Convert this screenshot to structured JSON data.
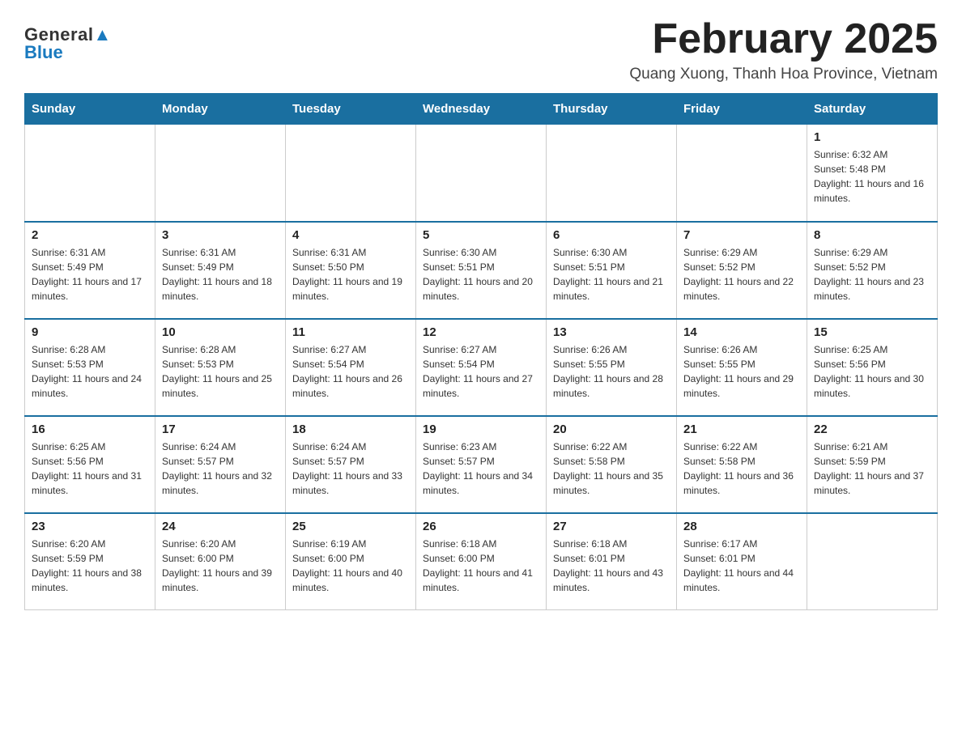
{
  "logo": {
    "general": "General",
    "blue": "Blue"
  },
  "title": "February 2025",
  "subtitle": "Quang Xuong, Thanh Hoa Province, Vietnam",
  "days_of_week": [
    "Sunday",
    "Monday",
    "Tuesday",
    "Wednesday",
    "Thursday",
    "Friday",
    "Saturday"
  ],
  "weeks": [
    [
      {
        "day": "",
        "info": ""
      },
      {
        "day": "",
        "info": ""
      },
      {
        "day": "",
        "info": ""
      },
      {
        "day": "",
        "info": ""
      },
      {
        "day": "",
        "info": ""
      },
      {
        "day": "",
        "info": ""
      },
      {
        "day": "1",
        "info": "Sunrise: 6:32 AM\nSunset: 5:48 PM\nDaylight: 11 hours and 16 minutes."
      }
    ],
    [
      {
        "day": "2",
        "info": "Sunrise: 6:31 AM\nSunset: 5:49 PM\nDaylight: 11 hours and 17 minutes."
      },
      {
        "day": "3",
        "info": "Sunrise: 6:31 AM\nSunset: 5:49 PM\nDaylight: 11 hours and 18 minutes."
      },
      {
        "day": "4",
        "info": "Sunrise: 6:31 AM\nSunset: 5:50 PM\nDaylight: 11 hours and 19 minutes."
      },
      {
        "day": "5",
        "info": "Sunrise: 6:30 AM\nSunset: 5:51 PM\nDaylight: 11 hours and 20 minutes."
      },
      {
        "day": "6",
        "info": "Sunrise: 6:30 AM\nSunset: 5:51 PM\nDaylight: 11 hours and 21 minutes."
      },
      {
        "day": "7",
        "info": "Sunrise: 6:29 AM\nSunset: 5:52 PM\nDaylight: 11 hours and 22 minutes."
      },
      {
        "day": "8",
        "info": "Sunrise: 6:29 AM\nSunset: 5:52 PM\nDaylight: 11 hours and 23 minutes."
      }
    ],
    [
      {
        "day": "9",
        "info": "Sunrise: 6:28 AM\nSunset: 5:53 PM\nDaylight: 11 hours and 24 minutes."
      },
      {
        "day": "10",
        "info": "Sunrise: 6:28 AM\nSunset: 5:53 PM\nDaylight: 11 hours and 25 minutes."
      },
      {
        "day": "11",
        "info": "Sunrise: 6:27 AM\nSunset: 5:54 PM\nDaylight: 11 hours and 26 minutes."
      },
      {
        "day": "12",
        "info": "Sunrise: 6:27 AM\nSunset: 5:54 PM\nDaylight: 11 hours and 27 minutes."
      },
      {
        "day": "13",
        "info": "Sunrise: 6:26 AM\nSunset: 5:55 PM\nDaylight: 11 hours and 28 minutes."
      },
      {
        "day": "14",
        "info": "Sunrise: 6:26 AM\nSunset: 5:55 PM\nDaylight: 11 hours and 29 minutes."
      },
      {
        "day": "15",
        "info": "Sunrise: 6:25 AM\nSunset: 5:56 PM\nDaylight: 11 hours and 30 minutes."
      }
    ],
    [
      {
        "day": "16",
        "info": "Sunrise: 6:25 AM\nSunset: 5:56 PM\nDaylight: 11 hours and 31 minutes."
      },
      {
        "day": "17",
        "info": "Sunrise: 6:24 AM\nSunset: 5:57 PM\nDaylight: 11 hours and 32 minutes."
      },
      {
        "day": "18",
        "info": "Sunrise: 6:24 AM\nSunset: 5:57 PM\nDaylight: 11 hours and 33 minutes."
      },
      {
        "day": "19",
        "info": "Sunrise: 6:23 AM\nSunset: 5:57 PM\nDaylight: 11 hours and 34 minutes."
      },
      {
        "day": "20",
        "info": "Sunrise: 6:22 AM\nSunset: 5:58 PM\nDaylight: 11 hours and 35 minutes."
      },
      {
        "day": "21",
        "info": "Sunrise: 6:22 AM\nSunset: 5:58 PM\nDaylight: 11 hours and 36 minutes."
      },
      {
        "day": "22",
        "info": "Sunrise: 6:21 AM\nSunset: 5:59 PM\nDaylight: 11 hours and 37 minutes."
      }
    ],
    [
      {
        "day": "23",
        "info": "Sunrise: 6:20 AM\nSunset: 5:59 PM\nDaylight: 11 hours and 38 minutes."
      },
      {
        "day": "24",
        "info": "Sunrise: 6:20 AM\nSunset: 6:00 PM\nDaylight: 11 hours and 39 minutes."
      },
      {
        "day": "25",
        "info": "Sunrise: 6:19 AM\nSunset: 6:00 PM\nDaylight: 11 hours and 40 minutes."
      },
      {
        "day": "26",
        "info": "Sunrise: 6:18 AM\nSunset: 6:00 PM\nDaylight: 11 hours and 41 minutes."
      },
      {
        "day": "27",
        "info": "Sunrise: 6:18 AM\nSunset: 6:01 PM\nDaylight: 11 hours and 43 minutes."
      },
      {
        "day": "28",
        "info": "Sunrise: 6:17 AM\nSunset: 6:01 PM\nDaylight: 11 hours and 44 minutes."
      },
      {
        "day": "",
        "info": ""
      }
    ]
  ]
}
